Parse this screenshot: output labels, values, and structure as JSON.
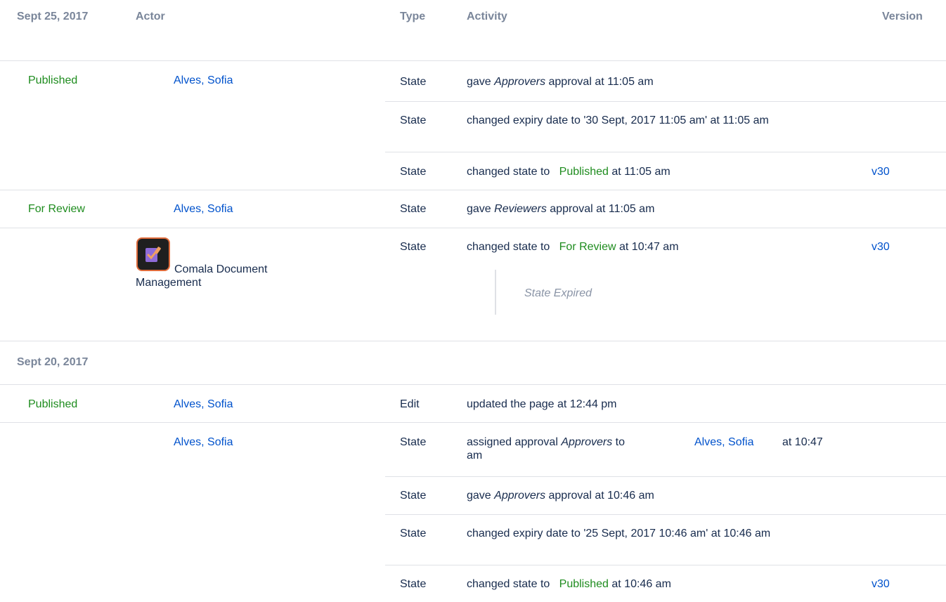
{
  "headers": {
    "date1": "Sept 25, 2017",
    "actor": "Actor",
    "type": "Type",
    "activity": "Activity",
    "version": "Version"
  },
  "date2": "Sept 20, 2017",
  "states": {
    "published": "Published",
    "for_review": "For Review"
  },
  "actor": {
    "name": "Alves, Sofia",
    "app_name": "Comala Document Management"
  },
  "types": {
    "state": "State",
    "edit": "Edit"
  },
  "version": "v30",
  "activities": {
    "r1": {
      "pre": "gave ",
      "em": "Approvers",
      "post": " approval at 11:05 am"
    },
    "r2": "changed expiry date to '30 Sept, 2017 11:05 am' at 11:05 am",
    "r3": {
      "pre": "changed state to",
      "state": "Published",
      "post": "at 11:05 am"
    },
    "r4": {
      "pre": "gave ",
      "em": "Reviewers",
      "post": " approval at 11:05 am"
    },
    "r5": {
      "pre": "changed state to",
      "state": "For Review",
      "post": "at 10:47 am",
      "note": "State Expired"
    },
    "r6": "updated the page at 12:44 pm",
    "r7": {
      "pre": "assigned approval ",
      "em": "Approvers",
      "post": " to",
      "user": "Alves, Sofia",
      "time": "at 10:47",
      "wrap": "am"
    },
    "r8": {
      "pre": "gave ",
      "em": "Approvers",
      "post": " approval at 10:46 am"
    },
    "r9": "changed expiry date to '25 Sept, 2017 10:46 am' at 10:46 am",
    "r10": {
      "pre": "changed state to",
      "state": "Published",
      "post": "at 10:46 am"
    }
  }
}
